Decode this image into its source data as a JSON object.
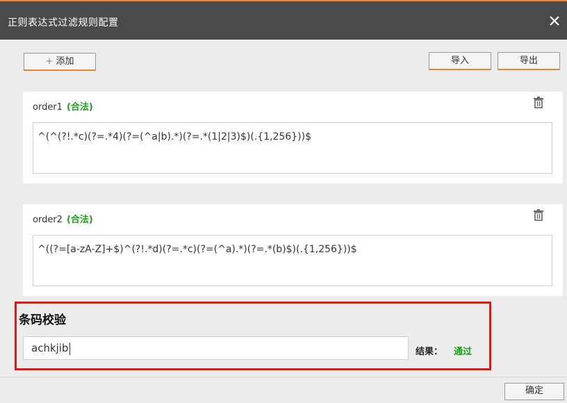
{
  "window": {
    "title": "正则表达式过滤规则配置",
    "accent_color": "#e9832e",
    "titlebar_color": "#4a4a4a"
  },
  "toolbar": {
    "add_icon": "+",
    "add_label": "添加",
    "import_label": "导入",
    "export_label": "导出"
  },
  "rules": [
    {
      "name": "order1",
      "status": "(合法)",
      "expression": "^(^(?!.*c)(?=.*4)(?=(^a|b).*)(?=.*(1|2|3)$)(.{1,256}))$"
    },
    {
      "name": "order2",
      "status": "(合法)",
      "expression": "^((?=[a-zA-Z]+$)^(?!.*d)(?=.*c)(?=(^a).*)(?=.*(b)$)(.{1,256}))$"
    }
  ],
  "barcode_check": {
    "title": "条码校验",
    "input_value": "achkjib",
    "result_label": "结果：",
    "result_value": "通过",
    "result_color": "#18a218",
    "highlight_color": "#e01717"
  },
  "footer": {
    "ok_label": "确定"
  }
}
